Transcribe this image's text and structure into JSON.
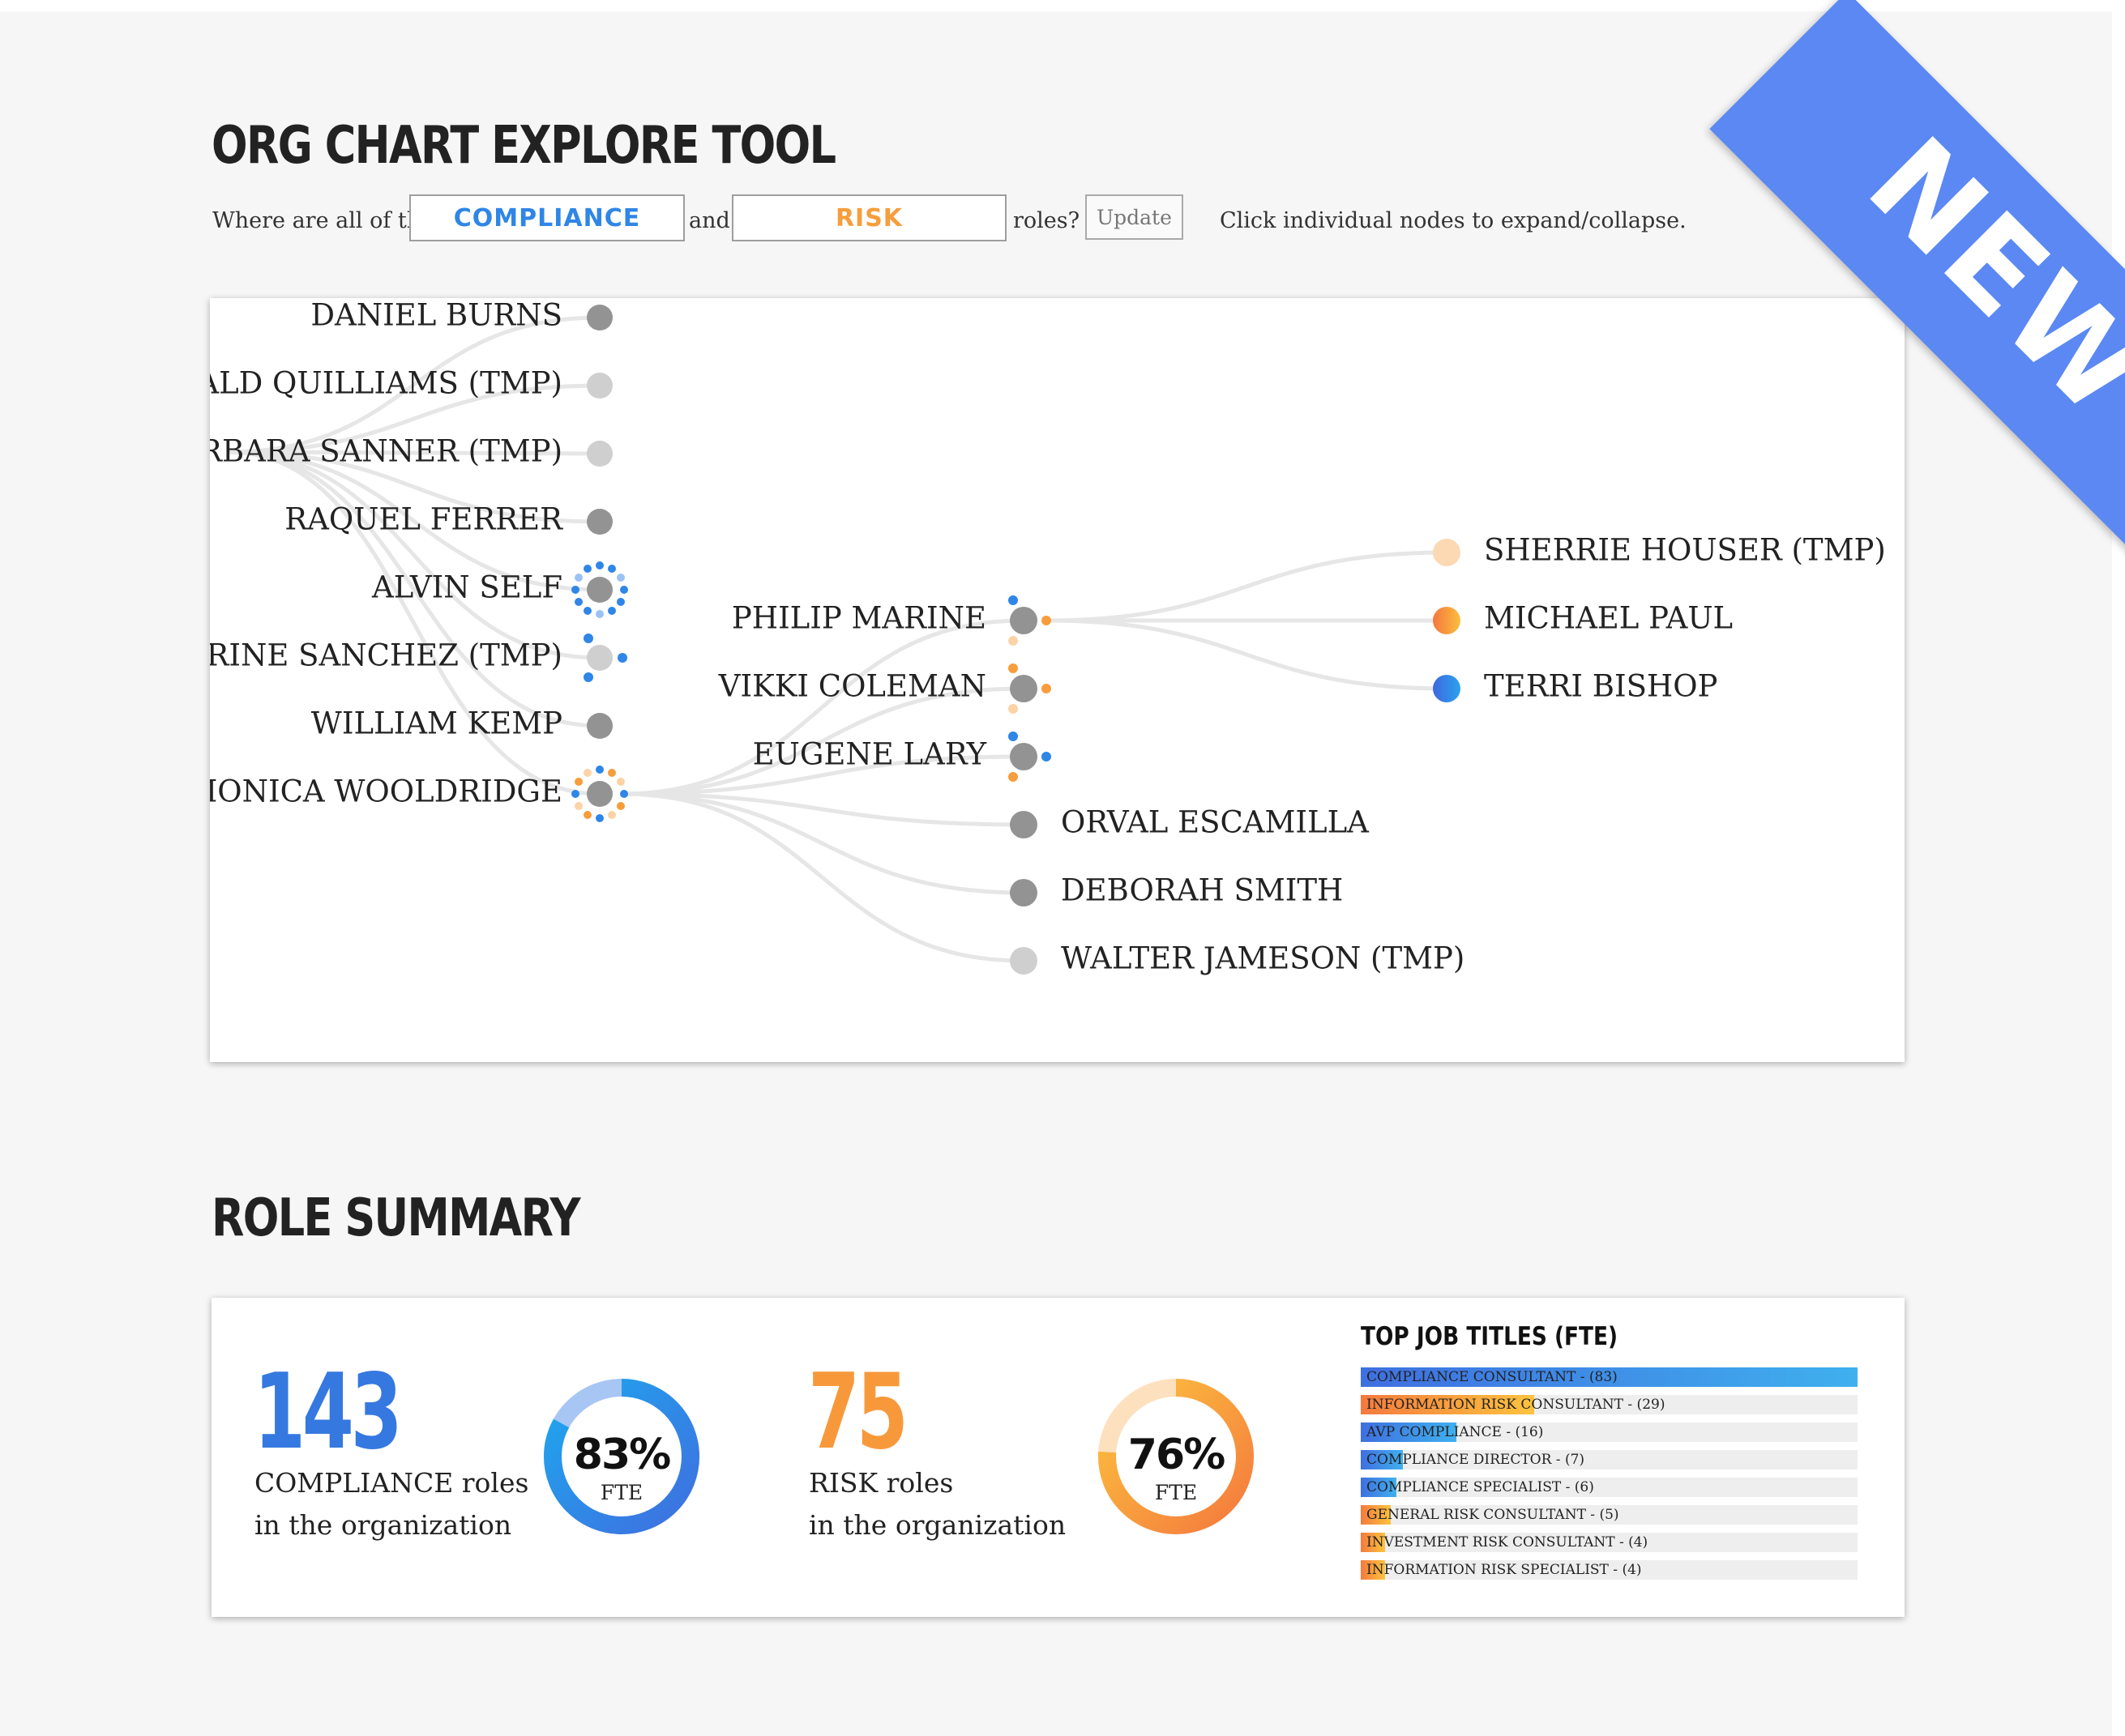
{
  "header": {
    "title": "ORG CHART EXPLORE TOOL"
  },
  "query": {
    "prefix": "Where are all of the",
    "role_a": "COMPLIANCE",
    "connector": "and",
    "role_b": "RISK",
    "suffix": "roles?",
    "update_label": "Update",
    "hint": "Click individual nodes to expand/collapse."
  },
  "ribbon": {
    "label": "NEW",
    "color": "#5b88f3"
  },
  "colors": {
    "compliance": "#2f86e6",
    "risk": "#f79d3c",
    "node_regular": "#939393",
    "node_temp": "#cfcfcf",
    "link": "#e6e6e6"
  },
  "tree": {
    "root_nodes": [
      {
        "name": "DANIEL BURNS",
        "type": "regular",
        "markers": []
      },
      {
        "name": "DONALD QUILLIAMS (TMP)",
        "type": "temp",
        "markers": []
      },
      {
        "name": "BARBARA SANNER (TMP)",
        "type": "temp",
        "markers": []
      },
      {
        "name": "RAQUEL FERRER",
        "type": "regular",
        "markers": []
      },
      {
        "name": "ALVIN SELF",
        "type": "regular",
        "markers": [
          "compliance-ring"
        ]
      },
      {
        "name": "CATHERINE SANCHEZ (TMP)",
        "type": "temp",
        "markers": [
          "compliance"
        ]
      },
      {
        "name": "WILLIAM KEMP",
        "type": "regular",
        "markers": []
      },
      {
        "name": "MONICA WOOLDRIDGE",
        "type": "regular",
        "markers": [
          "mixed-ring"
        ]
      }
    ],
    "monica_reports": [
      {
        "name": "PHILIP MARINE",
        "type": "regular",
        "markers": [
          "compliance",
          "risk"
        ]
      },
      {
        "name": "VIKKI COLEMAN",
        "type": "regular",
        "markers": [
          "risk"
        ]
      },
      {
        "name": "EUGENE LARY",
        "type": "regular",
        "markers": [
          "compliance",
          "risk"
        ]
      },
      {
        "name": "ORVAL ESCAMILLA",
        "type": "regular",
        "markers": []
      },
      {
        "name": "DEBORAH SMITH",
        "type": "regular",
        "markers": []
      },
      {
        "name": "WALTER JAMESON (TMP)",
        "type": "temp",
        "markers": []
      }
    ],
    "philip_reports": [
      {
        "name": "SHERRIE HOUSER (TMP)",
        "role": "risk-temp"
      },
      {
        "name": "MICHAEL PAUL",
        "role": "risk"
      },
      {
        "name": "TERRI BISHOP",
        "role": "compliance"
      }
    ]
  },
  "summary": {
    "title": "ROLE SUMMARY",
    "compliance": {
      "count": "143",
      "label_line1": "COMPLIANCE roles",
      "label_line2": "in the organization",
      "fte_percent": 83,
      "fte_text": "83%",
      "fte_unit": "FTE"
    },
    "risk": {
      "count": "75",
      "label_line1": "RISK roles",
      "label_line2": "in the organization",
      "fte_percent": 76,
      "fte_text": "76%",
      "fte_unit": "FTE"
    },
    "top_titles": {
      "heading": "TOP JOB TITLES (FTE)",
      "items": [
        {
          "label": "COMPLIANCE CONSULTANT - (83)",
          "value": 83,
          "category": "compliance"
        },
        {
          "label": "INFORMATION RISK CONSULTANT - (29)",
          "value": 29,
          "category": "risk"
        },
        {
          "label": "AVP COMPLIANCE - (16)",
          "value": 16,
          "category": "compliance"
        },
        {
          "label": "COMPLIANCE DIRECTOR - (7)",
          "value": 7,
          "category": "compliance"
        },
        {
          "label": "COMPLIANCE SPECIALIST - (6)",
          "value": 6,
          "category": "compliance"
        },
        {
          "label": "GENERAL RISK CONSULTANT - (5)",
          "value": 5,
          "category": "risk"
        },
        {
          "label": "INVESTMENT RISK CONSULTANT - (4)",
          "value": 4,
          "category": "risk"
        },
        {
          "label": "INFORMATION RISK SPECIALIST - (4)",
          "value": 4,
          "category": "risk"
        }
      ]
    }
  }
}
